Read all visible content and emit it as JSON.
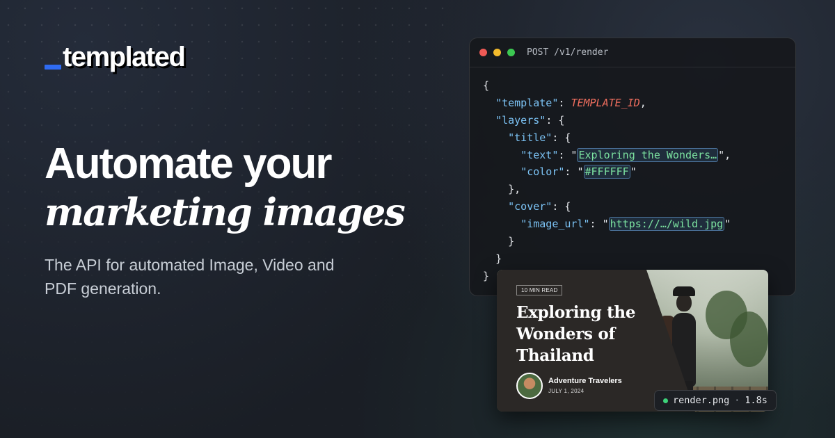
{
  "brand": {
    "logo_text": "templated",
    "accent": "#2f6bf2"
  },
  "hero": {
    "headline_line1": "Automate your",
    "headline_line2": "marketing images",
    "subtitle": "The API for automated Image, Video and PDF generation."
  },
  "code_window": {
    "endpoint": "POST /v1/render",
    "lines": {
      "open_brace": "{",
      "template_key": "\"template\"",
      "template_value": "TEMPLATE_ID",
      "layers_key": "\"layers\"",
      "title_key": "\"title\"",
      "text_key": "\"text\"",
      "text_value": "Exploring the Wonders…",
      "color_key": "\"color\"",
      "color_value": "#FFFFFF",
      "close_inner": "},",
      "cover_key": "\"cover\"",
      "image_url_key": "\"image_url\"",
      "image_url_value": "https://…/wild.jpg",
      "close_brace": "}"
    }
  },
  "preview_card": {
    "badge": "10 MIN READ",
    "title": "Exploring the Wonders of Thailand",
    "author": "Adventure Travelers",
    "date": "JULY 1, 2024"
  },
  "render_status": {
    "file": "render.png",
    "separator": "·",
    "duration": "1.8s",
    "status_color": "#3dd37a"
  }
}
